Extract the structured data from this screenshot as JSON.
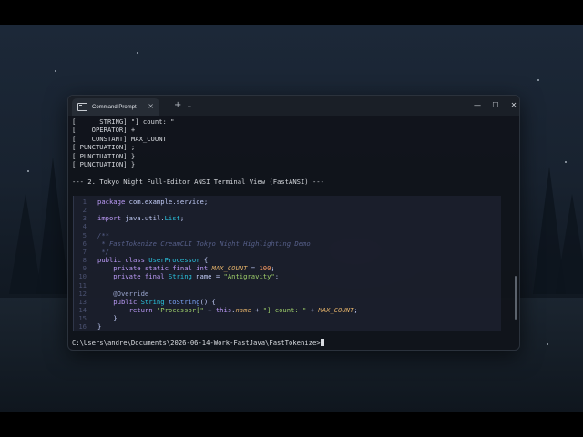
{
  "window": {
    "tab_title": "Command Prompt",
    "tab_close": "×",
    "new_tab": "+",
    "tab_dropdown": "⌄",
    "minimize": "—",
    "maximize": "☐",
    "close": "✕"
  },
  "output_lines": [
    "[      STRING] \"] count: \"",
    "[    OPERATOR] +",
    "[    CONSTANT] MAX_COUNT",
    "[ PUNCTUATION] ;",
    "[ PUNCTUATION] }",
    "[ PUNCTUATION] }",
    "",
    "--- 2. Tokyo Night Full-Editor ANSI Terminal View (FastANSI) ---"
  ],
  "editor": {
    "lines": [
      {
        "num": "1",
        "tokens": [
          {
            "t": "package",
            "c": "kw"
          },
          {
            "t": " com.example.service;",
            "c": "pl"
          }
        ]
      },
      {
        "num": "2",
        "tokens": []
      },
      {
        "num": "3",
        "tokens": [
          {
            "t": "import",
            "c": "kw"
          },
          {
            "t": " java.util.",
            "c": "pl"
          },
          {
            "t": "List",
            "c": "ty"
          },
          {
            "t": ";",
            "c": "pl"
          }
        ]
      },
      {
        "num": "4",
        "tokens": []
      },
      {
        "num": "5",
        "tokens": [
          {
            "t": "/**",
            "c": "cm"
          }
        ]
      },
      {
        "num": "6",
        "tokens": [
          {
            "t": " * FastTokenize CreamCLI Tokyo Night Highlighting Demo",
            "c": "cm"
          }
        ]
      },
      {
        "num": "7",
        "tokens": [
          {
            "t": " */",
            "c": "cm"
          }
        ]
      },
      {
        "num": "8",
        "tokens": [
          {
            "t": "public class",
            "c": "kw"
          },
          {
            "t": " ",
            "c": "pl"
          },
          {
            "t": "UserProcessor",
            "c": "ty"
          },
          {
            "t": " {",
            "c": "pl"
          }
        ]
      },
      {
        "num": "9",
        "tokens": [
          {
            "t": "    private static final int",
            "c": "kw"
          },
          {
            "t": " ",
            "c": "pl"
          },
          {
            "t": "MAX_COUNT",
            "c": "con"
          },
          {
            "t": " = ",
            "c": "pl"
          },
          {
            "t": "100",
            "c": "num"
          },
          {
            "t": ";",
            "c": "pl"
          }
        ]
      },
      {
        "num": "10",
        "tokens": [
          {
            "t": "    private final",
            "c": "kw"
          },
          {
            "t": " ",
            "c": "pl"
          },
          {
            "t": "String",
            "c": "ty"
          },
          {
            "t": " name = ",
            "c": "pl"
          },
          {
            "t": "\"Antigravity\"",
            "c": "str"
          },
          {
            "t": ";",
            "c": "pl"
          }
        ]
      },
      {
        "num": "11",
        "tokens": []
      },
      {
        "num": "12",
        "tokens": [
          {
            "t": "    @Override",
            "c": "ann"
          }
        ]
      },
      {
        "num": "13",
        "tokens": [
          {
            "t": "    public",
            "c": "kw"
          },
          {
            "t": " ",
            "c": "pl"
          },
          {
            "t": "String",
            "c": "ty"
          },
          {
            "t": " ",
            "c": "pl"
          },
          {
            "t": "toString",
            "c": "fn"
          },
          {
            "t": "() {",
            "c": "pl"
          }
        ]
      },
      {
        "num": "14",
        "tokens": [
          {
            "t": "        return",
            "c": "kw"
          },
          {
            "t": " ",
            "c": "pl"
          },
          {
            "t": "\"Processor[\"",
            "c": "str"
          },
          {
            "t": " + ",
            "c": "pl"
          },
          {
            "t": "this",
            "c": "kw"
          },
          {
            "t": ".",
            "c": "pl"
          },
          {
            "t": "name",
            "c": "con"
          },
          {
            "t": " + ",
            "c": "pl"
          },
          {
            "t": "\"] count: \"",
            "c": "str"
          },
          {
            "t": " + ",
            "c": "pl"
          },
          {
            "t": "MAX_COUNT",
            "c": "con"
          },
          {
            "t": ";",
            "c": "pl"
          }
        ]
      },
      {
        "num": "15",
        "tokens": [
          {
            "t": "    }",
            "c": "pl"
          }
        ]
      },
      {
        "num": "16",
        "tokens": [
          {
            "t": "}",
            "c": "pl"
          }
        ]
      }
    ]
  },
  "prompt": "C:\\Users\\andre\\Documents\\2026-06-14-Work-FastJava\\FastTokenize>"
}
